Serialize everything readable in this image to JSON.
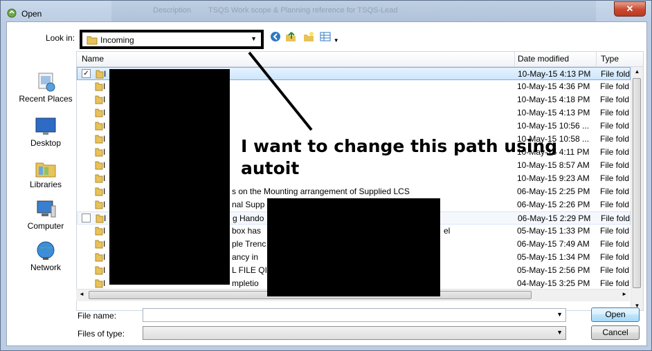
{
  "window": {
    "title": "Open",
    "close_label": "✕",
    "bg_text_1": "Description",
    "bg_text_2": "TSQS Work scope & Planning reference for TSQS-Lead"
  },
  "lookin": {
    "label": "Look in:",
    "value": "Incoming"
  },
  "places": [
    {
      "label": "Recent Places",
      "icon": "recent-places-icon"
    },
    {
      "label": "Desktop",
      "icon": "desktop-icon"
    },
    {
      "label": "Libraries",
      "icon": "libraries-icon"
    },
    {
      "label": "Computer",
      "icon": "computer-icon"
    },
    {
      "label": "Network",
      "icon": "network-icon"
    }
  ],
  "columns": {
    "name": "Name",
    "date": "Date modified",
    "type": "Type"
  },
  "rows": [
    {
      "name": "I",
      "date": "10-May-15 4:13 PM",
      "type": "File fold"
    },
    {
      "name": "I",
      "date": "10-May-15 4:36 PM",
      "type": "File fold"
    },
    {
      "name": "I",
      "date": "10-May-15 4:18 PM",
      "type": "File fold"
    },
    {
      "name": "I",
      "date": "10-May-15 4:13 PM",
      "type": "File fold"
    },
    {
      "name": "I",
      "date": "10-May-15 10:56 ...",
      "type": "File fold"
    },
    {
      "name": "I",
      "date": "10-May-15 10:58 ...",
      "type": "File fold"
    },
    {
      "name": "I",
      "date": "10-May-15 4:11 PM",
      "type": "File fold"
    },
    {
      "name": "I",
      "date": "10-May-15 8:57 AM",
      "type": "File fold"
    },
    {
      "name": "I",
      "date": "10-May-15 9:23 AM",
      "type": "File fold"
    },
    {
      "name": "I",
      "date": "06-May-15 2:25 PM",
      "type": "File fold",
      "tail": "s on the Mounting arrangement of Supplied LCS"
    },
    {
      "name": "I",
      "date": "06-May-15 2:26 PM",
      "type": "File fold",
      "tail": "nal Supp"
    },
    {
      "name": "I",
      "date": "06-May-15 2:29 PM",
      "type": "File fold",
      "tail": "g Hando"
    },
    {
      "name": "I",
      "date": "05-May-15 1:33 PM",
      "type": "File fold",
      "tail": "box has",
      "tail2": "el"
    },
    {
      "name": "I",
      "date": "06-May-15 7:49 AM",
      "type": "File fold",
      "tail": "ple Trenc"
    },
    {
      "name": "I",
      "date": "05-May-15 1:34 PM",
      "type": "File fold",
      "tail": "ancy in"
    },
    {
      "name": "I",
      "date": "05-May-15 2:56 PM",
      "type": "File fold",
      "tail": "L FILE QI"
    },
    {
      "name": "I",
      "date": "04-May-15 3:25 PM",
      "type": "File fold",
      "tail": "mpletio"
    }
  ],
  "filename": {
    "label": "File name:",
    "value": ""
  },
  "filetype": {
    "label": "Files of type:",
    "value": ""
  },
  "buttons": {
    "open": "Open",
    "cancel": "Cancel"
  },
  "annotation": {
    "line1": "I want to change this path using",
    "line2": "autoit"
  },
  "colors": {
    "folder": "#e8c25a",
    "accent": "#3c7fb1"
  }
}
